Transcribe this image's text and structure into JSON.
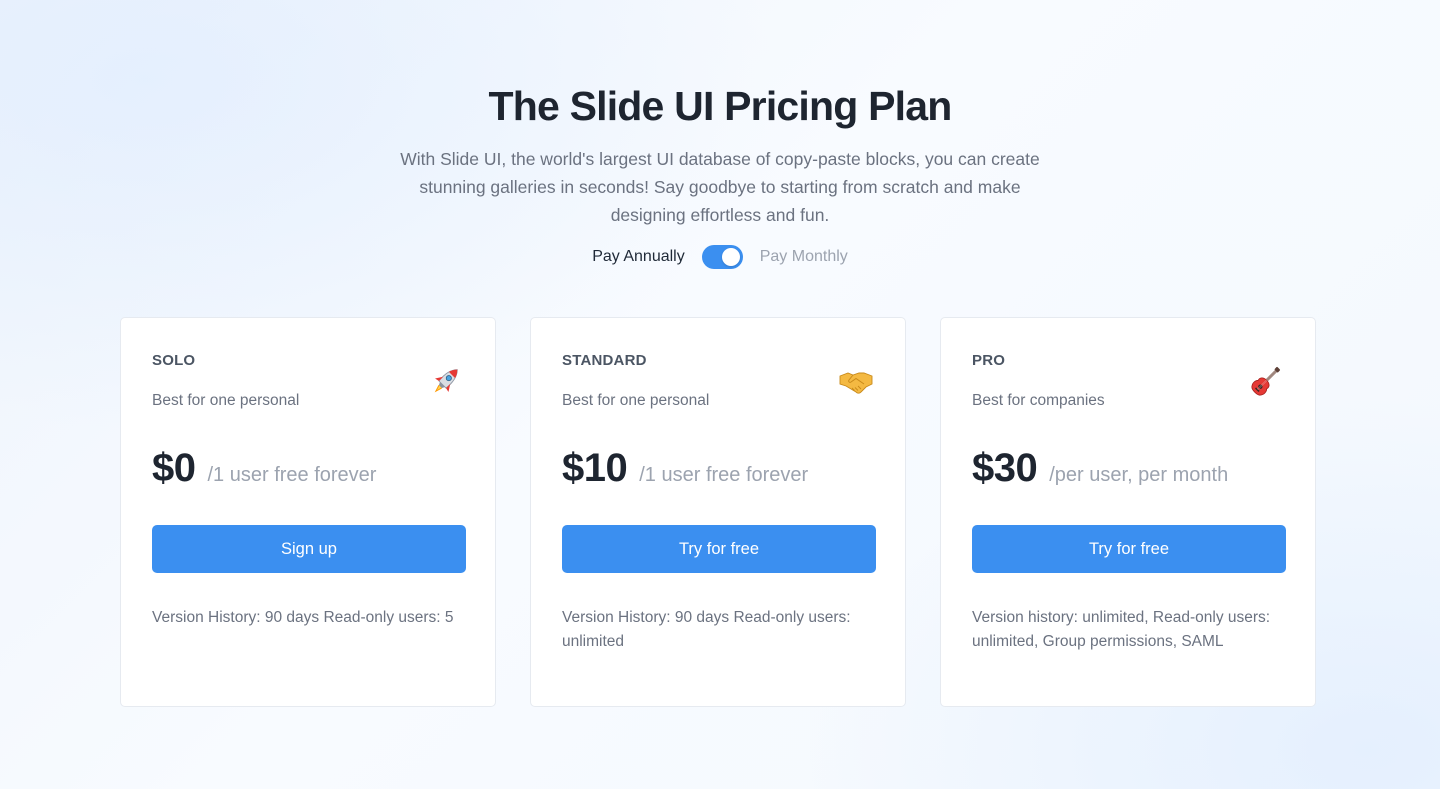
{
  "header": {
    "title": "The Slide UI Pricing Plan",
    "subtitle": "With Slide UI, the world's largest UI database of copy-paste blocks, you can create stunning galleries in seconds! Say goodbye to starting from scratch and make designing effortless and fun."
  },
  "billing": {
    "annual_label": "Pay Annually",
    "monthly_label": "Pay Monthly",
    "toggle_on": true
  },
  "colors": {
    "accent": "#3b8ff0",
    "title": "#1e2530",
    "muted": "#6b7280"
  },
  "plans": [
    {
      "name": "SOLO",
      "description": "Best for one personal",
      "icon": "rocket-icon",
      "icon_glyph": "🚀",
      "price": "$0",
      "price_note": "/1 user free forever",
      "cta": "Sign up",
      "features": "Version History: 90 days Read-only users: 5"
    },
    {
      "name": "STANDARD",
      "description": "Best for one personal",
      "icon": "handshake-icon",
      "icon_glyph": "🤝",
      "price": "$10",
      "price_note": "/1 user free forever",
      "cta": "Try for free",
      "features": "Version History: 90 days Read-only users: unlimited"
    },
    {
      "name": "PRO",
      "description": "Best for companies",
      "icon": "guitar-icon",
      "icon_glyph": "🎸",
      "price": "$30",
      "price_note": "/per user, per month",
      "cta": "Try for free",
      "features": "Version history: unlimited, Read-only users: unlimited, Group permissions, SAML"
    }
  ]
}
